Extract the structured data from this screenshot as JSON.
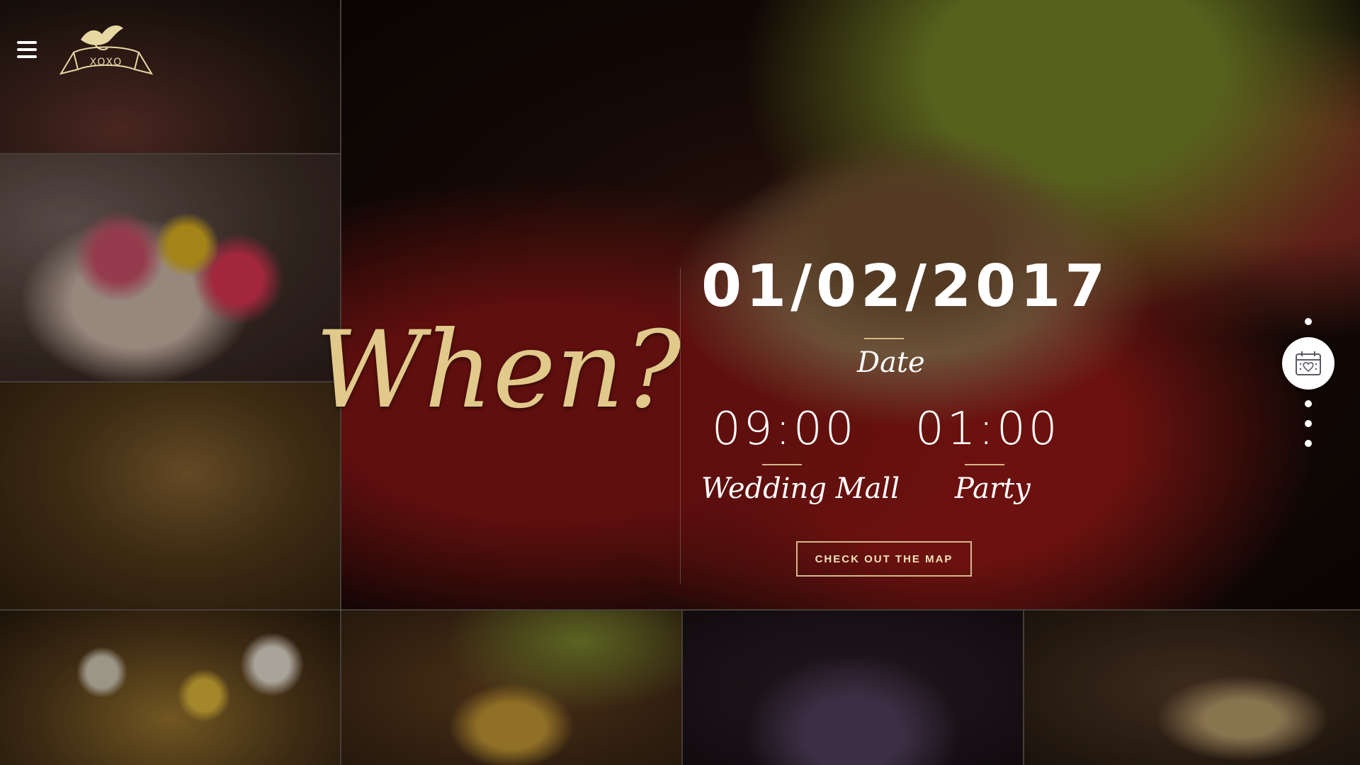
{
  "header": {
    "menu_icon": "hamburger-menu-icon",
    "logo_text": "XOXO"
  },
  "when": {
    "title": "When?",
    "date": "01/02/2017",
    "date_label": "Date",
    "events": [
      {
        "time": "09:00",
        "label": "Wedding Mall"
      },
      {
        "time": "01:00",
        "label": "Party"
      }
    ],
    "map_button": "CHECK OUT THE MAP"
  },
  "side_nav": {
    "active_icon": "calendar-heart-icon",
    "dot_count": 5,
    "active_index": 1
  },
  "colors": {
    "gold": "#d4b98a",
    "script_gold": "#e0c98a",
    "text": "#ffffff"
  }
}
